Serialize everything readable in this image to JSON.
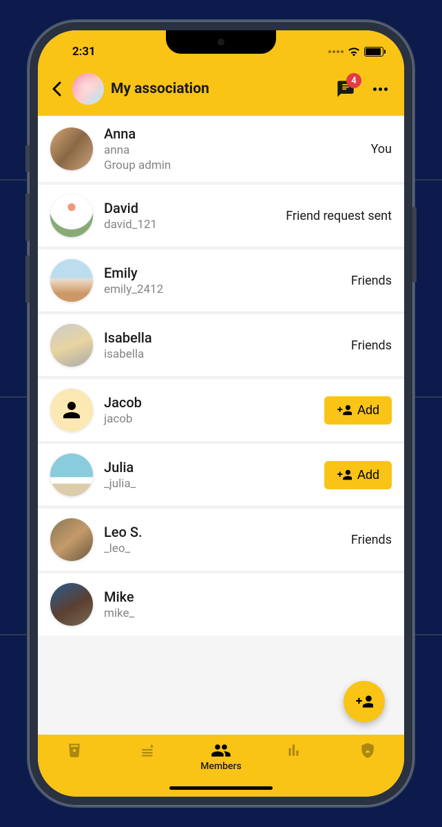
{
  "status_bar": {
    "time": "2:31"
  },
  "header": {
    "title": "My association",
    "chat_badge": "4"
  },
  "members": [
    {
      "name": "Anna",
      "username": "anna",
      "role": "Group admin",
      "status": "You",
      "action": "none"
    },
    {
      "name": "David",
      "username": "david_121",
      "status": "Friend request sent",
      "action": "none"
    },
    {
      "name": "Emily",
      "username": "emily_2412",
      "status": "Friends",
      "action": "none"
    },
    {
      "name": "Isabella",
      "username": "isabella",
      "status": "Friends",
      "action": "none"
    },
    {
      "name": "Jacob",
      "username": "jacob",
      "action": "add"
    },
    {
      "name": "Julia",
      "username": "_julia_",
      "action": "add"
    },
    {
      "name": "Leo S.",
      "username": "_leo_",
      "status": "Friends",
      "action": "none"
    },
    {
      "name": "Mike",
      "username": "mike_",
      "action": "fab"
    }
  ],
  "buttons": {
    "add": "Add"
  },
  "bottom_nav": {
    "items": [
      {
        "label": ""
      },
      {
        "label": ""
      },
      {
        "label": "Members",
        "active": true
      },
      {
        "label": ""
      },
      {
        "label": ""
      }
    ]
  }
}
